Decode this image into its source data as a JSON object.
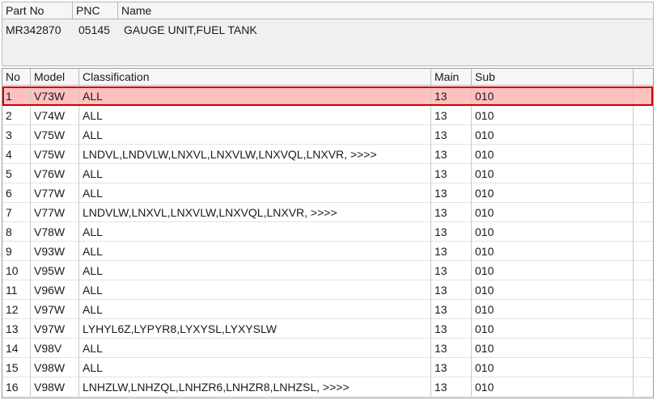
{
  "part_header": {
    "columns": [
      "Part No",
      "PNC",
      "Name"
    ],
    "part_no": "MR342870",
    "pnc": "05145",
    "name": "GAUGE UNIT,FUEL TANK"
  },
  "table": {
    "columns": [
      "No",
      "Model",
      "Classification",
      "Main",
      "Sub"
    ],
    "selected_row": 1,
    "rows": [
      {
        "no": "1",
        "model": "V73W",
        "classification": "ALL",
        "main": "13",
        "sub": "010"
      },
      {
        "no": "2",
        "model": "V74W",
        "classification": "ALL",
        "main": "13",
        "sub": "010"
      },
      {
        "no": "3",
        "model": "V75W",
        "classification": "ALL",
        "main": "13",
        "sub": "010"
      },
      {
        "no": "4",
        "model": "V75W",
        "classification": "LNDVL,LNDVLW,LNXVL,LNXVLW,LNXVQL,LNXVR,  >>>>",
        "main": "13",
        "sub": "010"
      },
      {
        "no": "5",
        "model": "V76W",
        "classification": "ALL",
        "main": "13",
        "sub": "010"
      },
      {
        "no": "6",
        "model": "V77W",
        "classification": "ALL",
        "main": "13",
        "sub": "010"
      },
      {
        "no": "7",
        "model": "V77W",
        "classification": "LNDVLW,LNXVL,LNXVLW,LNXVQL,LNXVR,  >>>>",
        "main": "13",
        "sub": "010"
      },
      {
        "no": "8",
        "model": "V78W",
        "classification": "ALL",
        "main": "13",
        "sub": "010"
      },
      {
        "no": "9",
        "model": "V93W",
        "classification": "ALL",
        "main": "13",
        "sub": "010"
      },
      {
        "no": "10",
        "model": "V95W",
        "classification": "ALL",
        "main": "13",
        "sub": "010"
      },
      {
        "no": "11",
        "model": "V96W",
        "classification": "ALL",
        "main": "13",
        "sub": "010"
      },
      {
        "no": "12",
        "model": "V97W",
        "classification": "ALL",
        "main": "13",
        "sub": "010"
      },
      {
        "no": "13",
        "model": "V97W",
        "classification": "LYHYL6Z,LYPYR8,LYXYSL,LYXYSLW",
        "main": "13",
        "sub": "010"
      },
      {
        "no": "14",
        "model": "V98V",
        "classification": "ALL",
        "main": "13",
        "sub": "010"
      },
      {
        "no": "15",
        "model": "V98W",
        "classification": "ALL",
        "main": "13",
        "sub": "010"
      },
      {
        "no": "16",
        "model": "V98W",
        "classification": "LNHZLW,LNHZQL,LNHZR6,LNHZR8,LNHZSL,  >>>>",
        "main": "13",
        "sub": "010"
      }
    ]
  },
  "colors": {
    "selected_fill": "#ffc0c0",
    "selected_border": "#cc0000",
    "header_bg": "#f6f6f6",
    "panel_bg": "#f0f0f0"
  }
}
